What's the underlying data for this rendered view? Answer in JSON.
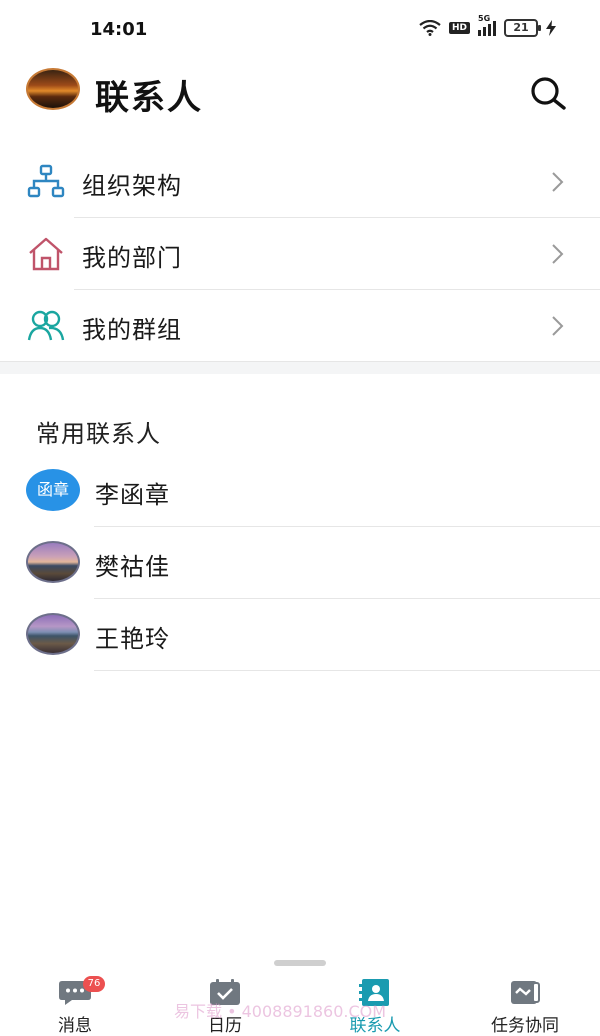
{
  "status_bar": {
    "time": "14:01",
    "hd_label": "HD",
    "network": "5G",
    "battery": "21"
  },
  "header": {
    "title": "联系人"
  },
  "menu": {
    "items": [
      {
        "label": "组织架构",
        "icon": "org-chart-icon",
        "color": "#2e86c1"
      },
      {
        "label": "我的部门",
        "icon": "home-icon",
        "color": "#c0546a"
      },
      {
        "label": "我的群组",
        "icon": "group-icon",
        "color": "#1aa6a0"
      }
    ]
  },
  "contacts": {
    "section_title": "常用联系人",
    "items": [
      {
        "name": "李函章",
        "avatar_text": "函章"
      },
      {
        "name": "樊祜佳",
        "avatar_text": ""
      },
      {
        "name": "王艳玲",
        "avatar_text": ""
      }
    ]
  },
  "tabbar": {
    "tabs": [
      {
        "label": "消息",
        "icon": "message-icon",
        "badge": "76"
      },
      {
        "label": "日历",
        "icon": "calendar-icon"
      },
      {
        "label": "联系人",
        "icon": "contacts-icon",
        "active": true
      },
      {
        "label": "任务协同",
        "icon": "task-icon"
      }
    ]
  },
  "watermark": "易下载 • 4008891860.COM",
  "colors": {
    "accent": "#1a9bb0",
    "badge": "#ec5050",
    "avatar_blue": "#2892e6"
  }
}
